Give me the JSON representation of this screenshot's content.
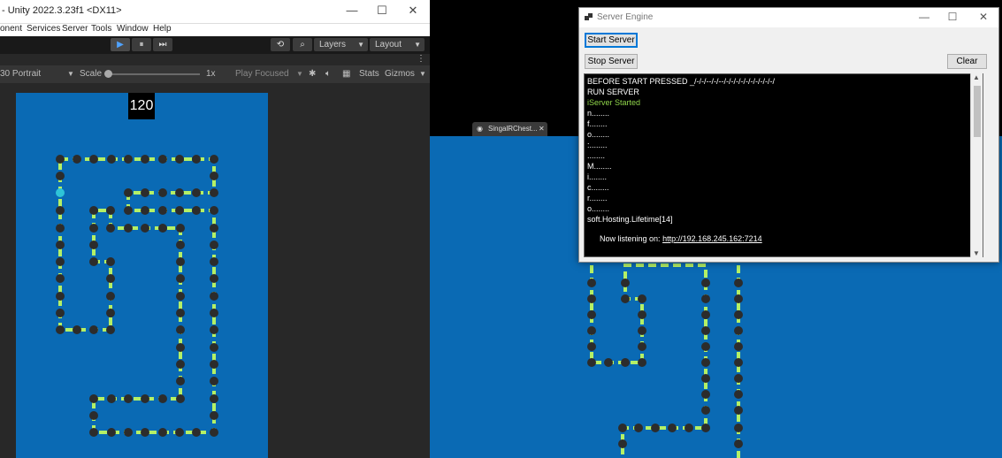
{
  "unity": {
    "title": "- Unity 2022.3.23f1 <DX11>",
    "window_controls": [
      "—",
      "☐",
      "✕"
    ],
    "menu": [
      "onent",
      "Services",
      "Server",
      "Tools",
      "Window",
      "Help"
    ],
    "toolbar": {
      "play": "▶",
      "pause": "⏸",
      "step": "⏭",
      "history": "⟲",
      "search": "⌕",
      "layers": "Layers",
      "layout": "Layout",
      "more": "⋮"
    },
    "gamebar": {
      "resolution": "30 Portrait",
      "scale_label": "Scale",
      "scale_value": "1x",
      "play_mode": "Play Focused",
      "stats": "Stats",
      "gizmos": "Gizmos"
    },
    "score": "120"
  },
  "tab": {
    "label": "SingalRChest...",
    "close": "✕"
  },
  "server": {
    "title": "Server Engine",
    "window_controls": [
      "—",
      "☐",
      "✕"
    ],
    "start_button": "Start Server",
    "stop_button": "Stop Server",
    "clear_button": "Clear",
    "console_lines": [
      {
        "text": "BEFORE START PRESSED _/-/-/--/-/--/-/-/-/-/-/-/-/-/-/-/",
        "color": "white"
      },
      {
        "text": "RUN SERVER",
        "color": "white"
      },
      {
        "text": "iServer Started",
        "color": "green"
      },
      {
        "text": "n........",
        "color": "white"
      },
      {
        "text": "f........",
        "color": "white"
      },
      {
        "text": "o........",
        "color": "white"
      },
      {
        "text": ":........",
        "color": "white"
      },
      {
        "text": " ........",
        "color": "white"
      },
      {
        "text": "M........",
        "color": "white"
      },
      {
        "text": "i........",
        "color": "white"
      },
      {
        "text": "c........",
        "color": "white"
      },
      {
        "text": "r........",
        "color": "white"
      },
      {
        "text": "o........",
        "color": "white"
      },
      {
        "text": "soft.Hosting.Lifetime[14]",
        "color": "white"
      }
    ],
    "listening_prefix": "Now listening on:",
    "listening_url": "http://192.168.245.162:7214"
  },
  "colors": {
    "game_background": "#0a6ab4",
    "track_green": "#b4f066",
    "node": "#2c2c2c",
    "head": "#2ec4d8",
    "console_green": "#8fd44a"
  }
}
